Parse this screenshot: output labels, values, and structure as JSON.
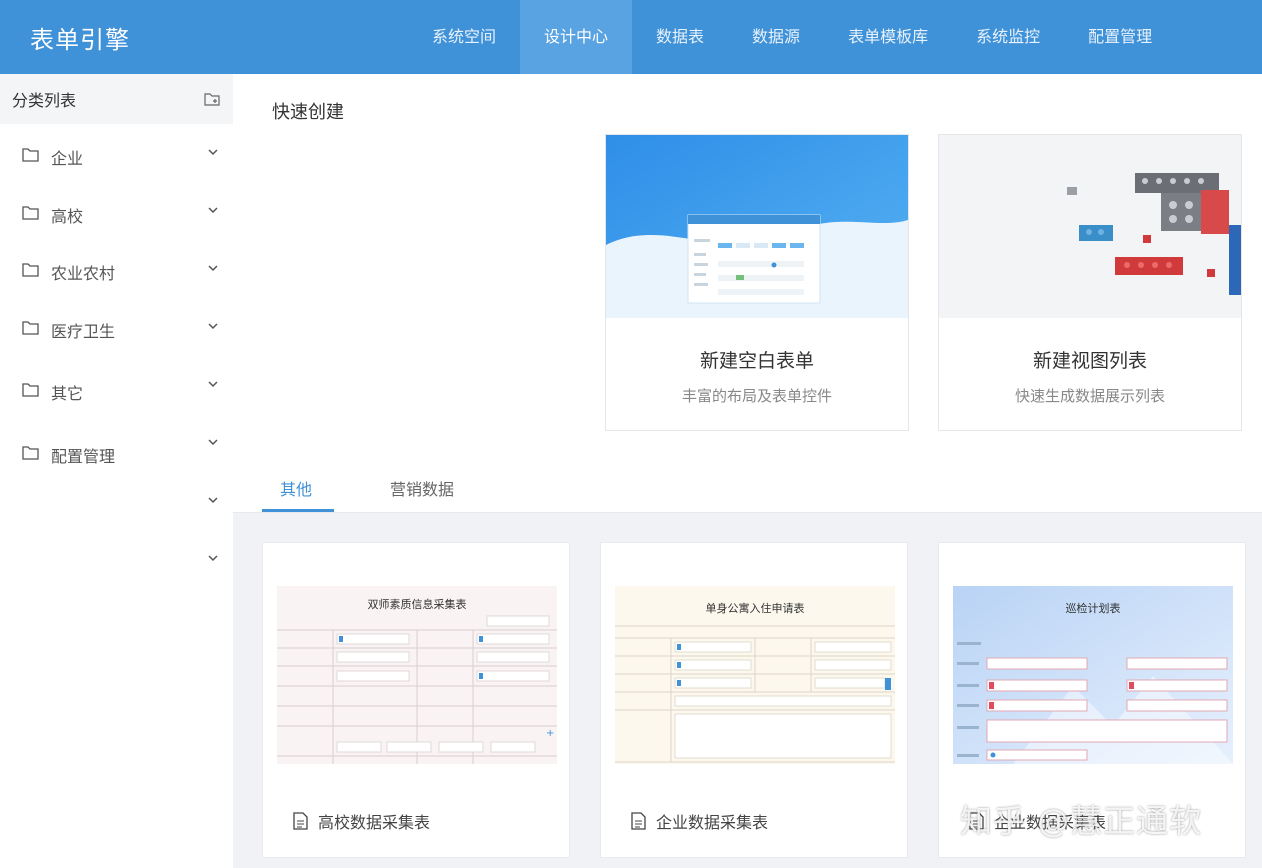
{
  "header": {
    "brand": "表单引擎",
    "nav": [
      "系统空间",
      "设计中心",
      "数据表",
      "数据源",
      "表单模板库",
      "系统监控",
      "配置管理"
    ],
    "active_nav": "设计中心"
  },
  "sidebar": {
    "title": "分类列表",
    "items": [
      {
        "label": "企业"
      },
      {
        "label": "高校"
      },
      {
        "label": "农业农村"
      },
      {
        "label": "医疗卫生"
      },
      {
        "label": "其它"
      },
      {
        "label": "配置管理"
      }
    ]
  },
  "main": {
    "quick_create_title": "快速创建",
    "quick_cards": [
      {
        "title": "新建空白表单",
        "subtitle": "丰富的布局及表单控件"
      },
      {
        "title": "新建视图列表",
        "subtitle": "快速生成数据展示列表"
      }
    ],
    "tabs": [
      {
        "label": "其他",
        "active": true
      },
      {
        "label": "营销数据",
        "active": false
      }
    ],
    "templates": [
      {
        "label": "高校数据采集表",
        "thumb_title": "双师素质信息采集表"
      },
      {
        "label": "企业数据采集表",
        "thumb_title": "单身公寓入住申请表"
      },
      {
        "label": "企业数据采集表",
        "thumb_title": "巡检计划表"
      }
    ],
    "watermark": "知乎 @慧正通软"
  },
  "colors": {
    "header": "#3f91d8",
    "nav_active": "#5aa3e3",
    "tab_active": "#3f91d8",
    "grid_bg": "#f0f2f5"
  }
}
